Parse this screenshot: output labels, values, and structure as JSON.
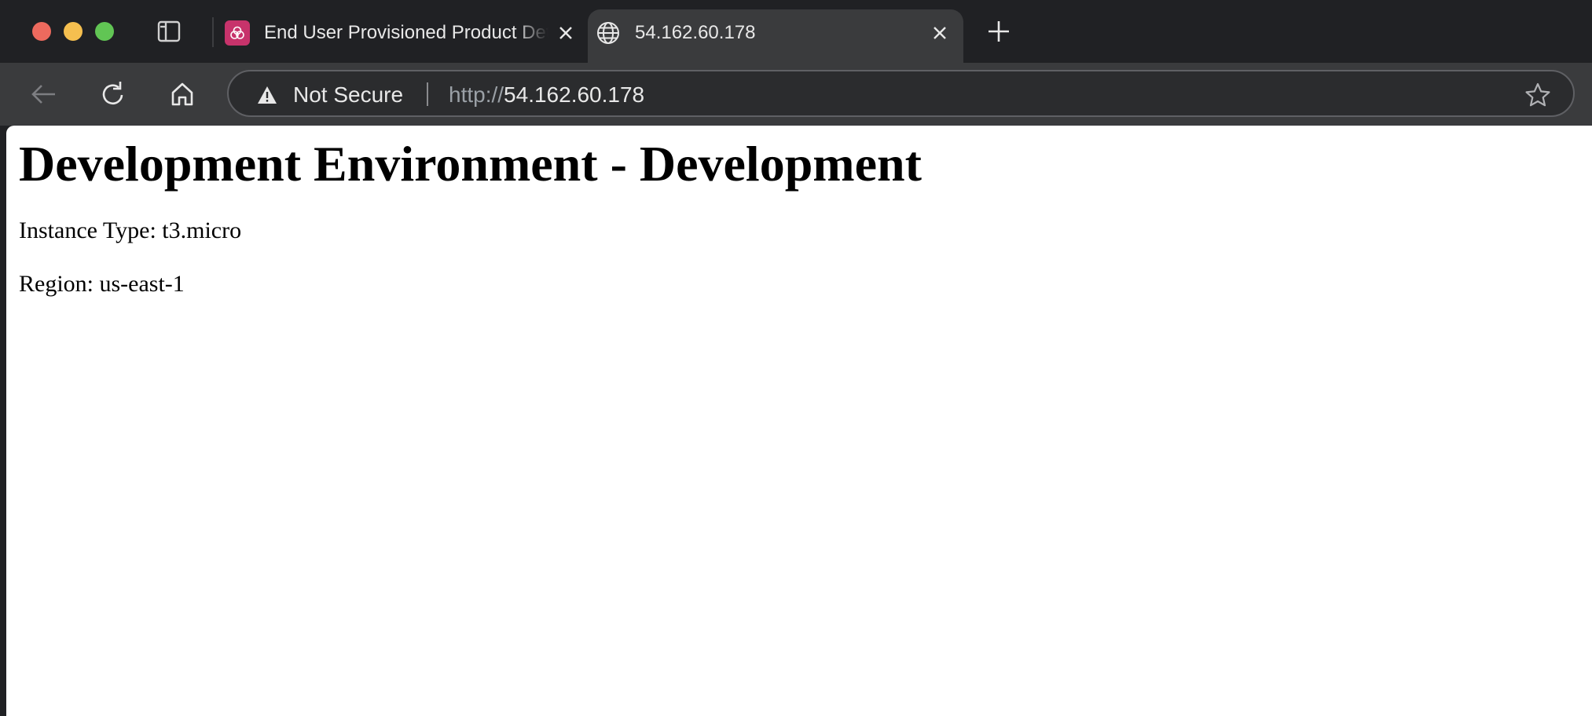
{
  "browser": {
    "tabs": [
      {
        "title": "End User Provisioned Product Details",
        "favicon": "service-catalog-icon",
        "active": false
      },
      {
        "title": "54.162.60.178",
        "favicon": "globe-icon",
        "active": true
      }
    ],
    "address_bar": {
      "security_label": "Not Secure",
      "url_scheme": "http://",
      "url_host": "54.162.60.178"
    },
    "colors": {
      "tabstrip": "#202124",
      "toolbar": "#3a3b3d",
      "close": "#ed6a5e",
      "minimize": "#f5bf4f",
      "zoom": "#61c554",
      "favicon_bg": "#c7336b"
    }
  },
  "page": {
    "heading": "Development Environment - Development",
    "instance_type": "Instance Type: t3.micro",
    "region": "Region: us-east-1"
  }
}
